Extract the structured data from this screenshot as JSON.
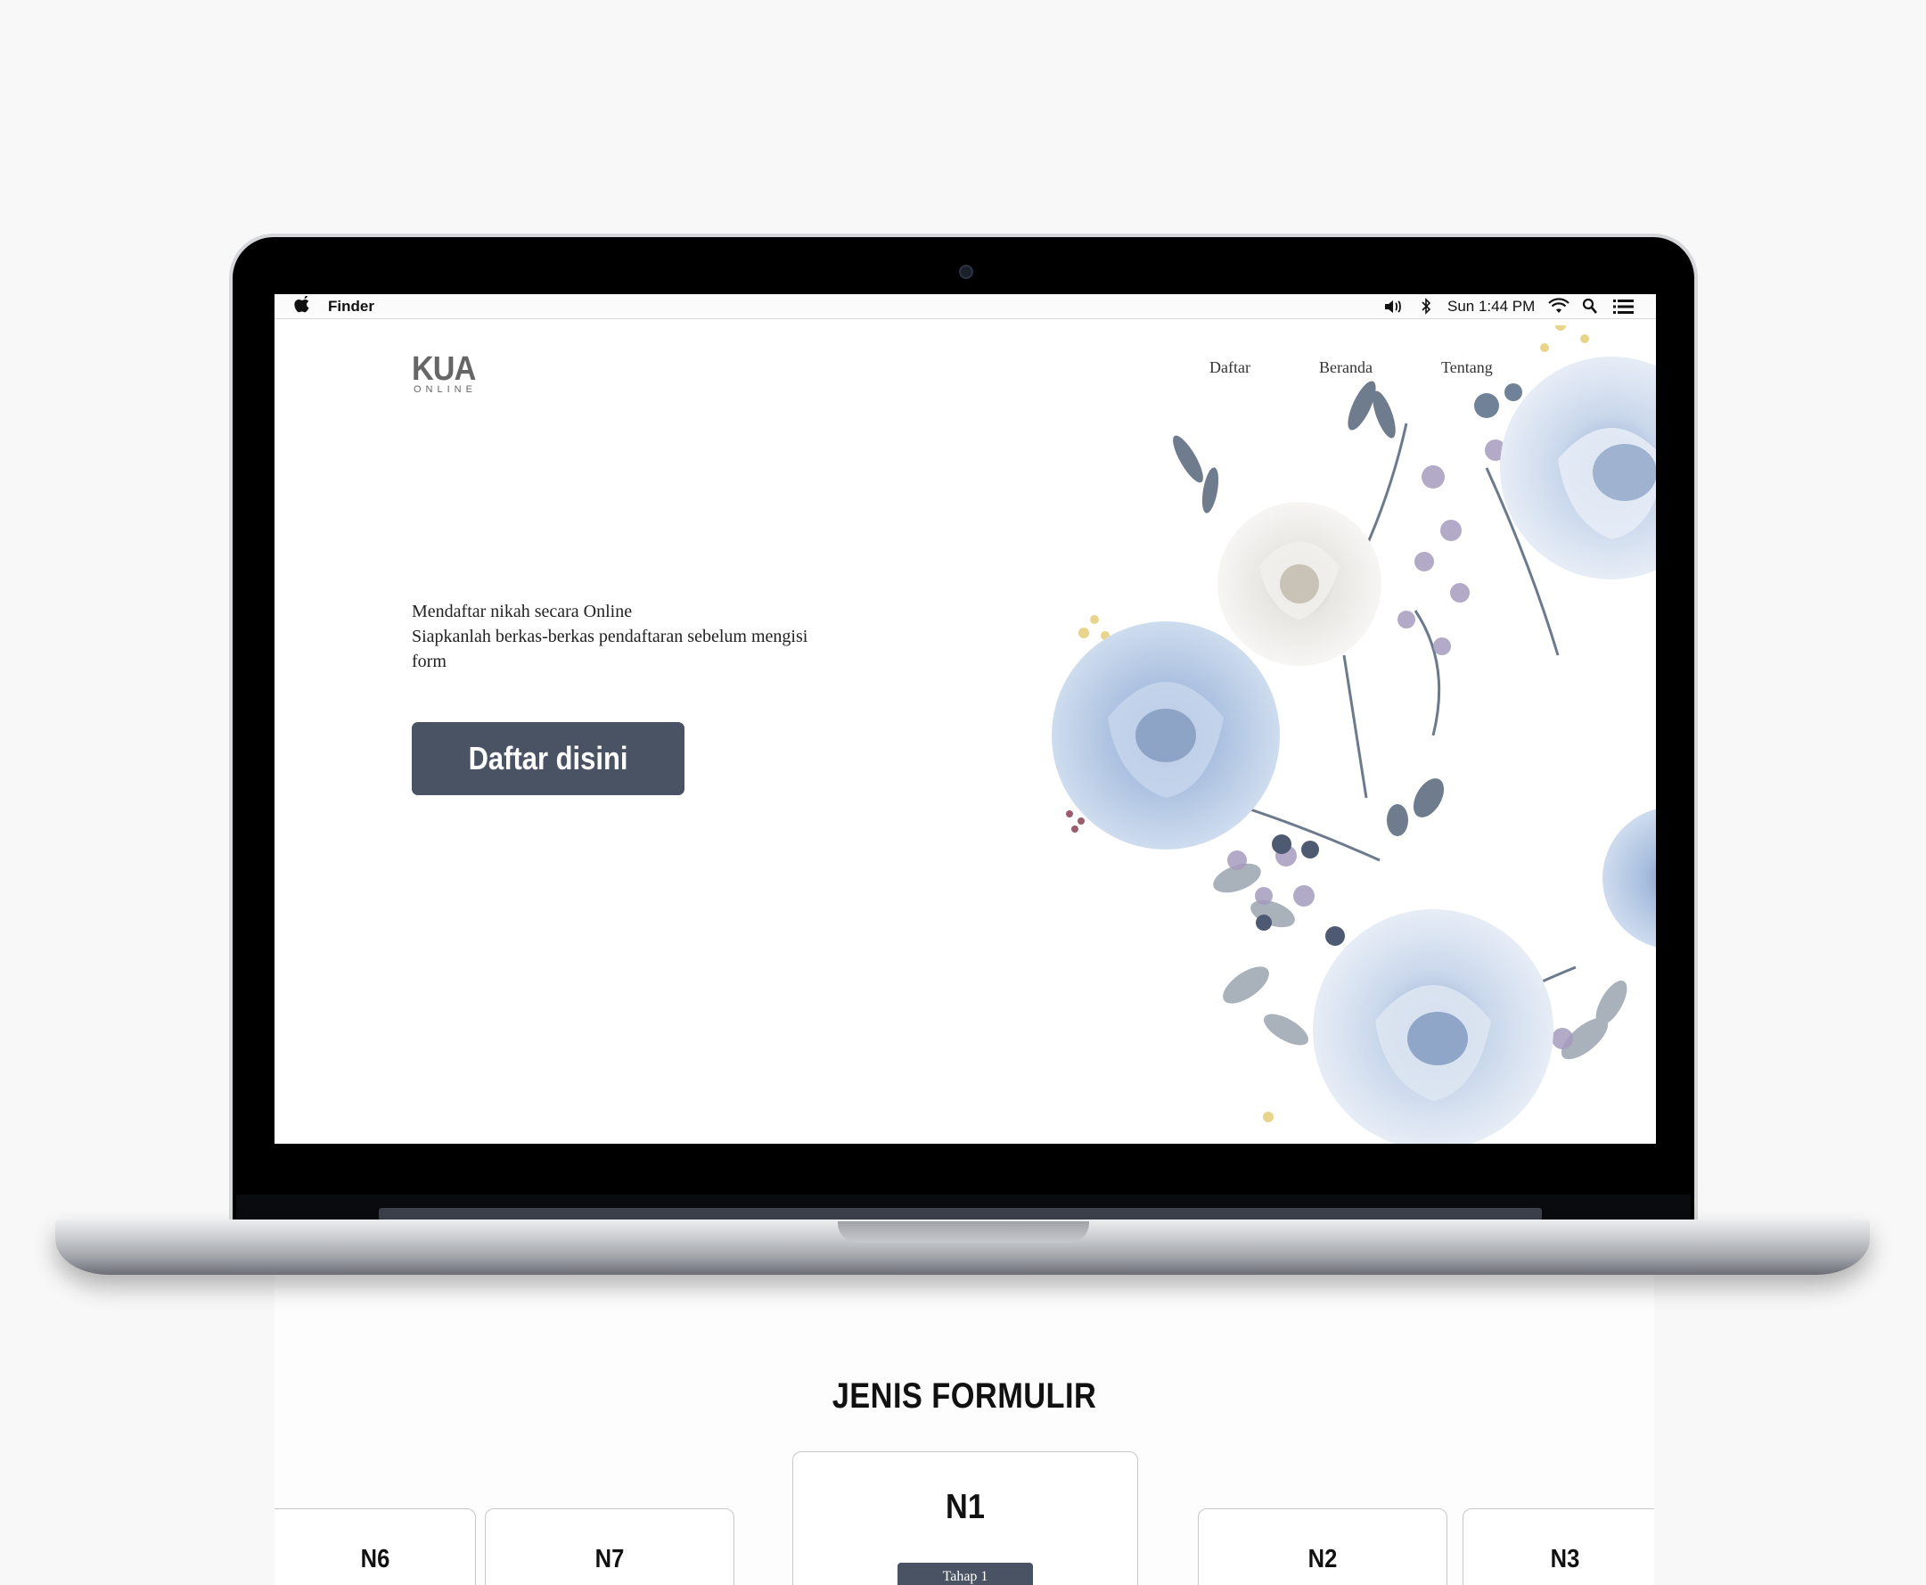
{
  "menubar": {
    "app_name": "Finder",
    "clock": "Sun 1:44 PM",
    "icons": [
      "apple-icon",
      "volume-icon",
      "bluetooth-icon",
      "wifi-icon",
      "spotlight-search-icon",
      "notification-list-icon"
    ]
  },
  "site": {
    "logo_main": "KUA",
    "logo_sub": "ONLINE",
    "nav": [
      "Daftar",
      "Beranda",
      "Tentang"
    ]
  },
  "hero": {
    "line1": "Mendaftar nikah secara Online",
    "line2": "Siapkanlah berkas-berkas pendaftaran sebelum mengisi form",
    "cta_label": "Daftar disini"
  },
  "forms_section": {
    "title": "JENIS FORMULIR",
    "cards": [
      {
        "code": "N6"
      },
      {
        "code": "N7"
      },
      {
        "code": "N1",
        "button": "Tahap 1"
      },
      {
        "code": "N2"
      },
      {
        "code": "N3"
      }
    ]
  },
  "colors": {
    "page_bg": "#f8f8f8",
    "button_dark": "#4a5363",
    "flower_blue": "#b9cce6",
    "leaf_slate": "#6b7a8c",
    "berry_purple": "#9a8fb4"
  }
}
